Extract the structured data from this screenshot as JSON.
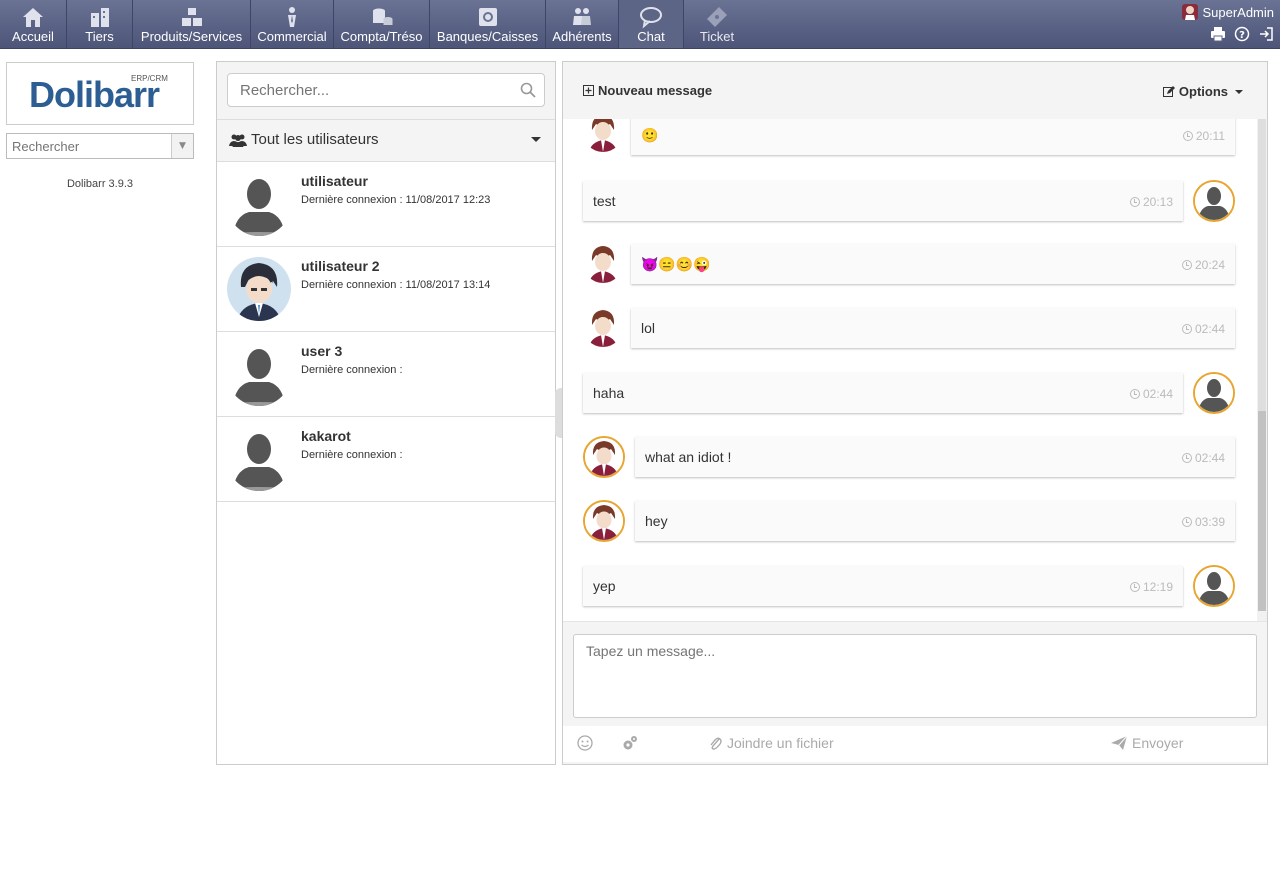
{
  "nav": {
    "items": [
      {
        "label": "Accueil",
        "icon": "home-icon"
      },
      {
        "label": "Tiers",
        "icon": "companies-icon"
      },
      {
        "label": "Produits/Services",
        "icon": "products-icon"
      },
      {
        "label": "Commercial",
        "icon": "commercial-icon"
      },
      {
        "label": "Compta/Tréso",
        "icon": "accounting-icon"
      },
      {
        "label": "Banques/Caisses",
        "icon": "bank-icon"
      },
      {
        "label": "Adhérents",
        "icon": "members-icon"
      },
      {
        "label": "Chat",
        "icon": "chat-icon"
      },
      {
        "label": "Ticket",
        "icon": "ticket-icon"
      }
    ],
    "active": "Chat",
    "user": "SuperAdmin"
  },
  "sidebar": {
    "logo": "Dolibarr",
    "logo_sub": "ERP/CRM",
    "search_placeholder": "Rechercher",
    "version": "Dolibarr 3.9.3"
  },
  "users": {
    "search_placeholder": "Rechercher...",
    "filter_label": "Tout les utilisateurs",
    "list": [
      {
        "name": "utilisateur",
        "last_login": "Dernière connexion : 11/08/2017 12:23",
        "avatar": "silhouette"
      },
      {
        "name": "utilisateur 2",
        "last_login": "Dernière connexion : 11/08/2017 13:14",
        "avatar": "anime"
      },
      {
        "name": "user 3",
        "last_login": "Dernière connexion :",
        "avatar": "silhouette"
      },
      {
        "name": "kakarot",
        "last_login": "Dernière connexion :",
        "avatar": "silhouette"
      }
    ]
  },
  "chat": {
    "new_message": "Nouveau message",
    "options": "Options",
    "messages": [
      {
        "text": "🙂",
        "time": "20:11",
        "side": "left"
      },
      {
        "text": "test",
        "time": "20:13",
        "side": "right"
      },
      {
        "text": "😈😑😊😜",
        "time": "20:24",
        "side": "left"
      },
      {
        "text": "lol",
        "time": "02:44",
        "side": "left"
      },
      {
        "text": "haha",
        "time": "02:44",
        "side": "right"
      },
      {
        "text": "what an idiot !",
        "time": "02:44",
        "side": "left"
      },
      {
        "text": "hey",
        "time": "03:39",
        "side": "left"
      },
      {
        "text": "yep",
        "time": "12:19",
        "side": "right"
      }
    ],
    "input_placeholder": "Tapez un message...",
    "attach_label": "Joindre un fichier",
    "send_label": "Envoyer"
  },
  "colors": {
    "nav_bg": "#5c6586",
    "avatar_ring": "#e8a530",
    "logo_blue": "#2c5e93"
  }
}
